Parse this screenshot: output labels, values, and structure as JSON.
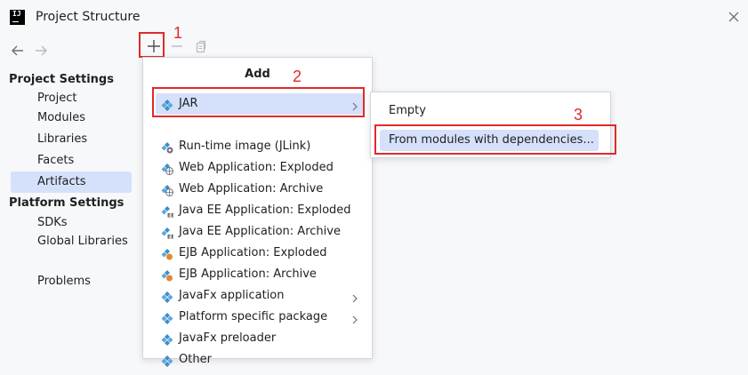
{
  "window": {
    "title": "Project Structure"
  },
  "sidebar": {
    "project_settings_heading": "Project Settings",
    "project_items": [
      "Project",
      "Modules",
      "Libraries",
      "Facets",
      "Artifacts"
    ],
    "platform_settings_heading": "Platform Settings",
    "platform_items": [
      "SDKs",
      "Global Libraries"
    ],
    "other_items": [
      "Problems"
    ],
    "selected": "Artifacts"
  },
  "add_menu": {
    "title": "Add",
    "items": [
      {
        "label": "JAR",
        "icon": "artifact-icon",
        "submenu": true,
        "selected": true
      },
      {
        "label": "Run-time image (JLink)",
        "icon": "jlink-icon",
        "submenu": false
      },
      {
        "label": "Web Application: Exploded",
        "icon": "web-icon",
        "submenu": false
      },
      {
        "label": "Web Application: Archive",
        "icon": "web-icon",
        "submenu": false
      },
      {
        "label": "Java EE Application: Exploded",
        "icon": "javaee-icon",
        "submenu": false
      },
      {
        "label": "Java EE Application: Archive",
        "icon": "javaee-icon",
        "submenu": false
      },
      {
        "label": "EJB Application: Exploded",
        "icon": "ejb-icon",
        "submenu": false
      },
      {
        "label": "EJB Application: Archive",
        "icon": "ejb-icon",
        "submenu": false
      },
      {
        "label": "JavaFx application",
        "icon": "artifact-icon",
        "submenu": true
      },
      {
        "label": "Platform specific package",
        "icon": "artifact-icon",
        "submenu": true
      },
      {
        "label": "JavaFx preloader",
        "icon": "artifact-icon",
        "submenu": false
      },
      {
        "label": "Other",
        "icon": "artifact-icon",
        "submenu": false
      }
    ]
  },
  "jar_submenu": {
    "items": [
      {
        "label": "Empty",
        "selected": false
      },
      {
        "label": "From modules with dependencies...",
        "selected": true
      }
    ]
  },
  "annotations": {
    "step1": "1",
    "step2": "2",
    "step3": "3"
  },
  "colors": {
    "accent_selected": "#d5e1fa",
    "annotation_red": "#e02a2a",
    "artifact_icon": "#3a8ec9"
  }
}
